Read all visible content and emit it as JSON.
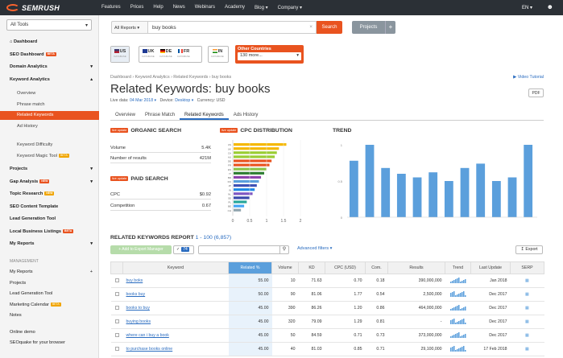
{
  "brand": "SEMRUSH",
  "topnav": {
    "items": [
      "Features",
      "Prices",
      "Help",
      "News",
      "Webinars",
      "Academy",
      "Blog ▾",
      "Company ▾"
    ],
    "lang": "EN ▾",
    "user_icon": "user-icon"
  },
  "sidebar": {
    "tools_select": "All Tools",
    "items": [
      {
        "label": "Dashboard",
        "type": "b",
        "icon": "home-icon"
      },
      {
        "label": "SEO Dashboard",
        "type": "b",
        "badge": "BETA"
      },
      {
        "label": "Domain Analytics",
        "type": "b",
        "arrow": "▾"
      },
      {
        "label": "Keyword Analytics",
        "type": "b",
        "arrow": "▴"
      },
      {
        "label": "Overview",
        "type": "sub"
      },
      {
        "label": "Phrase match",
        "type": "sub"
      },
      {
        "label": "Related Keywords",
        "type": "sub",
        "active": true
      },
      {
        "label": "Ad History",
        "type": "sub"
      },
      {
        "label": "Keyword Difficulty",
        "type": "sub"
      },
      {
        "label": "Keyword Magic Tool",
        "type": "sub",
        "badge": "BETA",
        "badge_color": "g"
      },
      {
        "label": "Projects",
        "type": "b",
        "arrow": "▾"
      },
      {
        "label": "Gap Analysis",
        "type": "b",
        "badge": "NEW",
        "arrow": "▾"
      },
      {
        "label": "Topic Research",
        "type": "b",
        "badge": "NEW",
        "badge_color": "g"
      },
      {
        "label": "SEO Content Template",
        "type": "b"
      },
      {
        "label": "Lead Generation Tool",
        "type": "b"
      },
      {
        "label": "Local Business Listings",
        "type": "b",
        "badge": "BETA"
      },
      {
        "label": "My Reports",
        "type": "b",
        "arrow": "▾"
      },
      {
        "label": "MANAGEMENT",
        "type": "cap"
      },
      {
        "label": "My Reports",
        "type": "m",
        "arrow": "+"
      },
      {
        "label": "Projects",
        "type": "m"
      },
      {
        "label": "Lead Generation Tool",
        "type": "m"
      },
      {
        "label": "Marketing Calendar",
        "type": "m",
        "badge": "BETA",
        "badge_color": "g"
      },
      {
        "label": "Notes",
        "type": "m"
      },
      {
        "label": "Online demo",
        "type": "m"
      },
      {
        "label": "SEOquake for your browser",
        "type": "m"
      }
    ]
  },
  "search": {
    "report_select": "All Reports ▾",
    "query": "buy books",
    "button": "Search",
    "projects": "Projects",
    "projects_add": "+"
  },
  "databases": [
    {
      "code": "US",
      "db": "DATABASE",
      "active": true
    },
    {
      "code": "UK",
      "db": "DATABASE"
    },
    {
      "code": "DE",
      "db": "DATABASE"
    },
    {
      "code": "FR",
      "db": "DATABASE"
    },
    {
      "code": "IN",
      "db": "DATABASE"
    }
  ],
  "other_countries": {
    "title": "Other Countries",
    "value": "130 more..."
  },
  "breadcrumb": "Dashboard  ›  Keyword Analytics  ›  Related Keywords  ›  buy books",
  "video_tutorial": "Video Tutorial",
  "page_title": "Related Keywords: buy books",
  "pdf": "PDF",
  "meta": {
    "live_label": "Live data:",
    "live_value": "04 Mar 2018 ▾",
    "device_label": "Device:",
    "device_value": "Desktop ▾",
    "currency": "Currency: USD"
  },
  "tabs": [
    "Overview",
    "Phrase Match",
    "Related Keywords",
    "Ads History"
  ],
  "organic": {
    "badge": "live update",
    "title": "ORGANIC SEARCH",
    "rows": [
      {
        "k": "Volume",
        "v": "5.4K"
      },
      {
        "k": "Number of results",
        "v": "421M"
      }
    ]
  },
  "paid": {
    "badge": "live update",
    "title": "PAID SEARCH",
    "rows": [
      {
        "k": "CPC",
        "v": "$0.92"
      },
      {
        "k": "Competition",
        "v": "0.67"
      }
    ]
  },
  "cpc": {
    "badge": "live update",
    "title": "CPC DISTRIBUTION",
    "country_labels": [
      "US",
      "UK",
      "CA",
      "AU",
      "DE",
      "FR",
      "ES",
      "IT",
      "BR",
      "RU",
      "JP",
      "IN",
      "NL",
      "SE",
      "PL",
      "BE",
      "CH"
    ],
    "bar_values": [
      1.0,
      0.86,
      0.82,
      0.78,
      0.72,
      0.68,
      0.62,
      0.58,
      0.52,
      0.48,
      0.44,
      0.4,
      0.36,
      0.3,
      0.25,
      0.2,
      0.14
    ],
    "bar_colors": [
      "#f5b800",
      "#f5b800",
      "#9acd32",
      "#9acd32",
      "#e9531f",
      "#e9531f",
      "#8bc34a",
      "#2e7d32",
      "#8e44ad",
      "#5b9fdc",
      "#3f51b5",
      "#1e88e5",
      "#7e57c2",
      "#3949ab",
      "#26a69a",
      "#42a5f5",
      "#90a4ae"
    ],
    "x_ticks": [
      "0",
      "0.5",
      "1",
      "1.5",
      "2"
    ]
  },
  "trend": {
    "title": "TREND",
    "y_ticks": [
      "1",
      "0.5",
      "0"
    ],
    "values": [
      0.78,
      1.0,
      0.68,
      0.6,
      0.55,
      0.62,
      0.5,
      0.68,
      0.74,
      0.5,
      0.55,
      1.0
    ]
  },
  "report": {
    "title": "RELATED KEYWORDS REPORT",
    "range": "1 - 100 (6,857)",
    "export_manager": "+ Add to Export Manager",
    "checked_count": "74",
    "advanced_filters": "Advanced filters ▾",
    "export": "Export",
    "columns": [
      "",
      "Keyword",
      "Related %",
      "Volume",
      "KD",
      "CPC (USD)",
      "Com.",
      "Results",
      "Trend",
      "Last Update",
      "SERP"
    ],
    "rows": [
      {
        "kw": "buy boks",
        "rel": "55.00",
        "vol": "10",
        "kd": "71.63",
        "cpc": "0.70",
        "com": "0.18",
        "res": "390,000,000",
        "upd": "Jan 2018"
      },
      {
        "kw": "books buy",
        "rel": "50.00",
        "vol": "90",
        "kd": "81.06",
        "cpc": "1.77",
        "com": "0.54",
        "res": "2,500,000",
        "upd": "Dec 2017"
      },
      {
        "kw": "books to buy",
        "rel": "45.00",
        "vol": "390",
        "kd": "86.26",
        "cpc": "1.20",
        "com": "0.86",
        "res": "464,000,000",
        "upd": "Dec 2017"
      },
      {
        "kw": "buying books",
        "rel": "45.00",
        "vol": "320",
        "kd": "79.09",
        "cpc": "1.29",
        "com": "0.81",
        "res": "-",
        "upd": "Dec 2017"
      },
      {
        "kw": "where can i buy a book",
        "rel": "45.00",
        "vol": "50",
        "kd": "84.59",
        "cpc": "0.71",
        "com": "0.73",
        "res": "373,000,000",
        "upd": "Dec 2017"
      },
      {
        "kw": "to purchase books online",
        "rel": "45.00",
        "vol": "40",
        "kd": "81.03",
        "cpc": "0.85",
        "com": "0.71",
        "res": "29,100,000",
        "upd": "17 Feb 2018"
      }
    ]
  }
}
